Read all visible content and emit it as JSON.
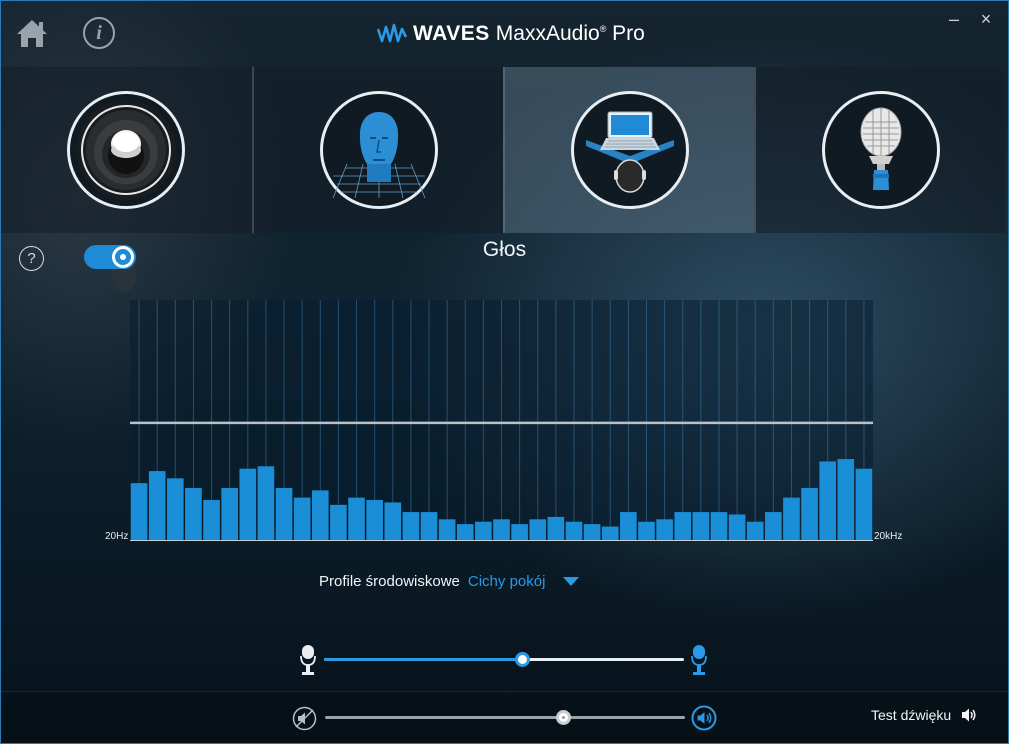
{
  "app": {
    "brand": "WAVES",
    "product": "MaxxAudio",
    "product_suffix": "Pro",
    "registered": "®"
  },
  "window_controls": {
    "minimize": "–",
    "close": "×"
  },
  "tabs": [
    {
      "name": "speaker",
      "icon": "speaker-icon",
      "active": false
    },
    {
      "name": "3d-audio",
      "icon": "head-3d-icon",
      "active": false
    },
    {
      "name": "voice",
      "icon": "laptop-listener-icon",
      "active": true
    },
    {
      "name": "microphone",
      "icon": "studio-microphone-icon",
      "active": false
    }
  ],
  "help": {
    "glyph": "?"
  },
  "info": {
    "glyph": "i"
  },
  "main": {
    "title": "Głos",
    "toggle_on": true
  },
  "equalizer": {
    "min_label": "20Hz",
    "max_label": "20kHz",
    "reference_level": 0.49,
    "bar_color": "#1a8fd8",
    "band_levels": [
      0.24,
      0.29,
      0.26,
      0.22,
      0.17,
      0.22,
      0.3,
      0.31,
      0.22,
      0.18,
      0.21,
      0.15,
      0.18,
      0.17,
      0.16,
      0.12,
      0.12,
      0.09,
      0.07,
      0.08,
      0.09,
      0.07,
      0.09,
      0.1,
      0.08,
      0.07,
      0.06,
      0.12,
      0.08,
      0.09,
      0.12,
      0.12,
      0.12,
      0.11,
      0.08,
      0.12,
      0.18,
      0.22,
      0.33,
      0.34,
      0.3
    ]
  },
  "profile": {
    "label": "Profile środowiskowe",
    "value": "Cichy pokój"
  },
  "mic_balance": {
    "value": 0.55,
    "accent": "#2a9ae6"
  },
  "volume": {
    "value": 0.66
  },
  "test_sound": {
    "label": "Test dźwięku"
  }
}
